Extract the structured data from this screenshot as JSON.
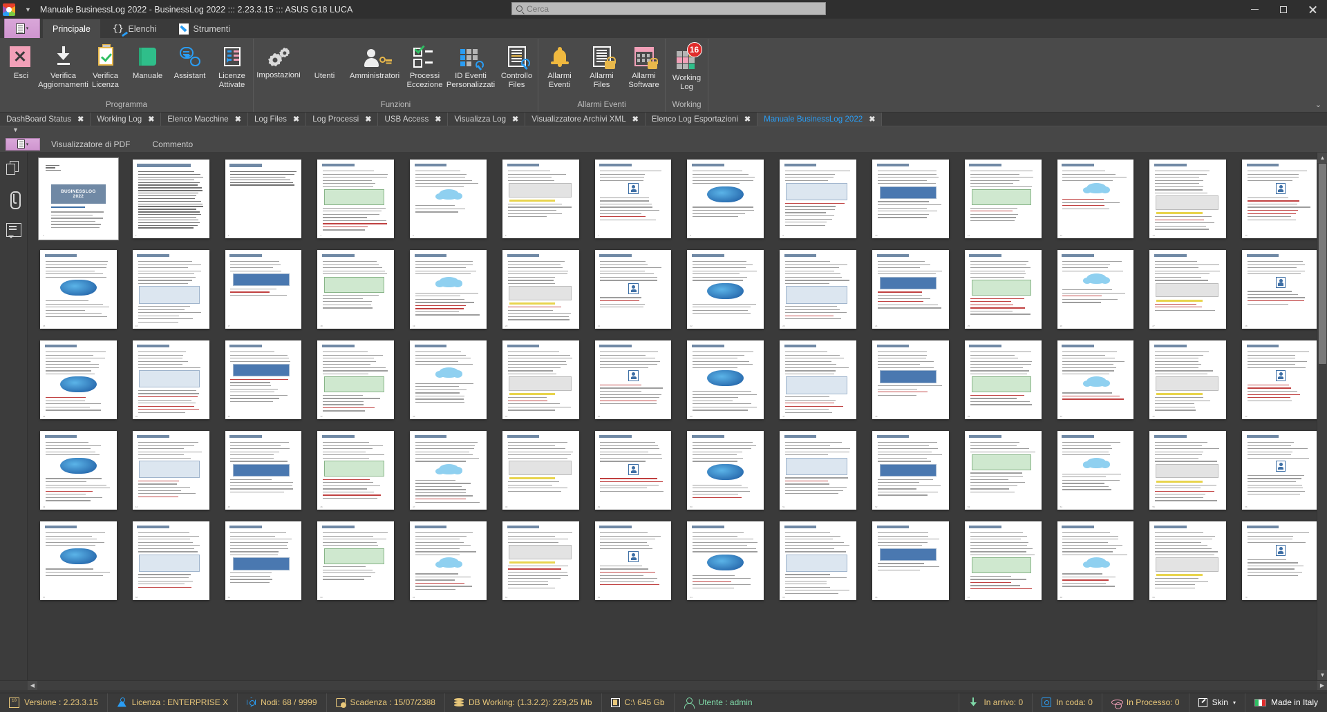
{
  "titlebar": {
    "title": "Manuale BusinessLog 2022 - BusinessLog 2022 ::: 2.23.3.15 ::: ASUS G18 LUCA",
    "qat_caret": "▼",
    "search_placeholder": "Cerca",
    "search_value": "",
    "minimize_label": "Riduci a icona",
    "maximize_label": "Ingrandisci",
    "close_label": "Chiudi"
  },
  "ribbon": {
    "file_tab_label": "",
    "tabs": [
      {
        "label": "Principale",
        "icon": "document-list-icon",
        "active": true
      },
      {
        "label": "Elenchi",
        "icon": "braces-pen-icon",
        "active": false
      },
      {
        "label": "Strumenti",
        "icon": "wrench-icon",
        "active": false
      }
    ],
    "collapse_label": "⌄",
    "groups": [
      {
        "name": "Programma",
        "items": [
          {
            "label": "Esci",
            "icon": "exit-x-icon"
          },
          {
            "label": "Verifica Aggiornamenti",
            "icon": "download-icon"
          },
          {
            "label": "Verifica Licenza",
            "icon": "clipboard-check-icon"
          },
          {
            "label": "Manuale",
            "icon": "book-icon"
          },
          {
            "label": "Assistant",
            "icon": "chat-bubbles-icon"
          },
          {
            "label": "Licenze Attivate",
            "icon": "license-list-icon"
          }
        ]
      },
      {
        "name": "Funzioni",
        "items": [
          {
            "label": "Impostazioni",
            "icon": "gears-icon"
          },
          {
            "label": "Utenti",
            "icon": "users-icon"
          },
          {
            "label": "Amministratori",
            "icon": "user-key-icon"
          },
          {
            "label": "Processi Eccezione",
            "icon": "checkbox-list-icon"
          },
          {
            "label": "ID Eventi Personalizzati",
            "icon": "grid-wrench-icon"
          },
          {
            "label": "Controllo Files",
            "icon": "document-search-icon"
          }
        ]
      },
      {
        "name": "Allarmi Eventi",
        "items": [
          {
            "label": "Allarmi Eventi",
            "icon": "bell-icon"
          },
          {
            "label": "Allarmi Files",
            "icon": "document-lock-icon"
          },
          {
            "label": "Allarmi Software",
            "icon": "calendar-lock-icon"
          }
        ]
      },
      {
        "name": "Working",
        "items": [
          {
            "label": "Working Log",
            "icon": "working-grid-icon",
            "badge": "16"
          }
        ]
      }
    ]
  },
  "doctabs": {
    "close_glyph": "✖",
    "items": [
      {
        "label": "DashBoard Status",
        "active": false
      },
      {
        "label": "Working Log",
        "active": false
      },
      {
        "label": "Elenco Macchine",
        "active": false
      },
      {
        "label": "Log Files",
        "active": false
      },
      {
        "label": "Log Processi",
        "active": false
      },
      {
        "label": "USB Access",
        "active": false
      },
      {
        "label": "Visualizza Log",
        "active": false
      },
      {
        "label": "Visualizzatore Archivi XML",
        "active": false
      },
      {
        "label": "Elenco Log Esportazioni",
        "active": false
      },
      {
        "label": "Manuale BusinessLog 2022",
        "active": true
      }
    ]
  },
  "pdf_subbar": {
    "caret": "▼",
    "tabs": [
      {
        "label": "Visualizzatore di PDF"
      },
      {
        "label": "Commento"
      }
    ]
  },
  "left_rail": {
    "items": [
      {
        "name": "pages-icon",
        "label": "Pagine"
      },
      {
        "name": "attachment-icon",
        "label": "Allegati"
      },
      {
        "name": "comment-icon",
        "label": "Commenti"
      }
    ]
  },
  "pdf": {
    "cover_title": "BUSINESSLOG",
    "cover_year": "2022",
    "cover_version": "VERSIONE 2.23.3.15",
    "page_header": "BUSINESSLOG 2022",
    "toc_header": "SOMMARIO",
    "total_pages_visible": 70,
    "selected_page": 1
  },
  "scrollbars": {
    "up_glyph": "▲",
    "down_glyph": "▼",
    "left_glyph": "◀",
    "right_glyph": "▶"
  },
  "statusbar": {
    "left": [
      {
        "label": "Versione : 2.23.3.15",
        "icon": "version-icon",
        "color": "#e8c77a"
      },
      {
        "label": "Licenza : ENTERPRISE X",
        "icon": "license-icon",
        "color": "#e8c77a"
      },
      {
        "label": "Nodi: 68 / 9999",
        "icon": "nodes-icon",
        "color": "#e8c77a"
      },
      {
        "label": "Scadenza : 15/07/2388",
        "icon": "expiry-icon",
        "color": "#e8c77a"
      },
      {
        "label": "DB Working: (1.3.2.2): 229,25 Mb",
        "icon": "database-icon",
        "color": "#e8c77a"
      },
      {
        "label": "C:\\ 645 Gb",
        "icon": "disk-icon",
        "color": "#e8c77a"
      },
      {
        "label": "Utente : admin",
        "icon": "user-icon",
        "color": "#7fd9a8"
      }
    ],
    "right": [
      {
        "label": "In arrivo: 0",
        "icon": "inbound-icon",
        "color": "#e8c77a"
      },
      {
        "label": "In coda: 0",
        "icon": "queue-icon",
        "color": "#e8c77a"
      },
      {
        "label": "In Processo: 0",
        "icon": "processing-icon",
        "color": "#e8c77a"
      },
      {
        "label": "Skin",
        "icon": "skin-icon",
        "color": "#ffffff",
        "caret": "▾"
      },
      {
        "label": "Made in Italy",
        "icon": "italy-flag-icon",
        "color": "#ffffff"
      }
    ]
  }
}
